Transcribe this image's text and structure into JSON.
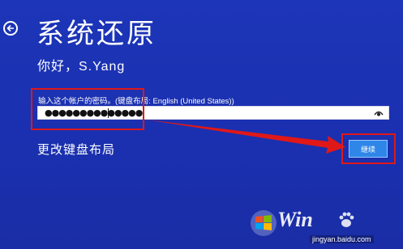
{
  "page": {
    "title": "系统还原",
    "greeting": "你好，S.Yang"
  },
  "password": {
    "label": "输入这个帐户的密码。(键盘布局: English (United States))",
    "masked_value": "●●●●●●●●●●●●●●"
  },
  "links": {
    "change_keyboard": "更改键盘布局"
  },
  "buttons": {
    "continue": "继续"
  },
  "watermark": {
    "brand": "Win",
    "site": "jingyan.baidu.com"
  },
  "colors": {
    "background": "#1a30b0",
    "button": "#2e86e8",
    "highlight": "#e01818"
  },
  "icons": [
    "back-arrow-icon",
    "reveal-password-icon",
    "windows-logo-icon",
    "baidu-paw-icon"
  ]
}
